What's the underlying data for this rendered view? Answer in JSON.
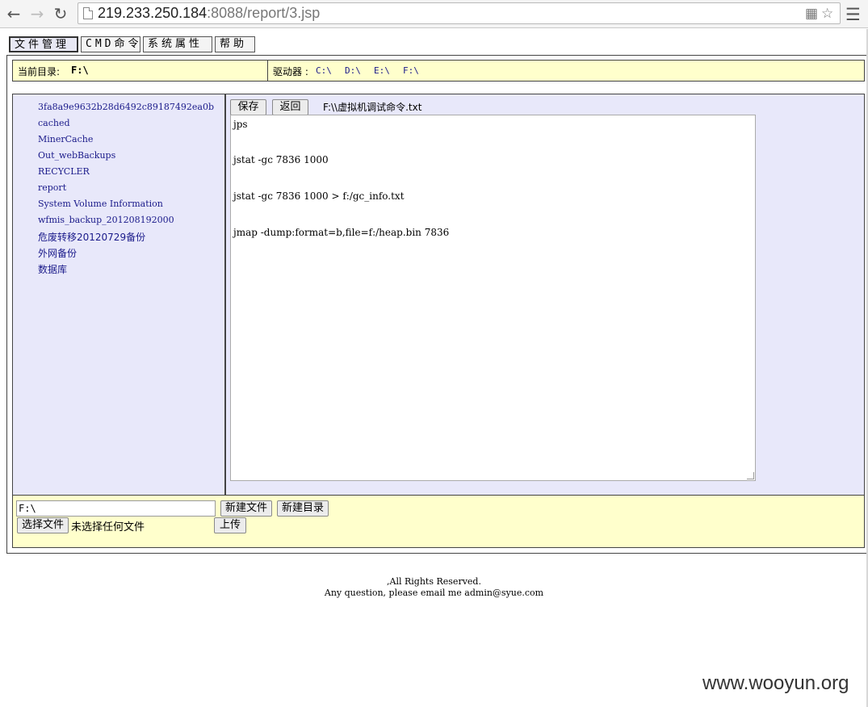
{
  "browser": {
    "url_host": "219.233.250.184",
    "url_rest": ":8088/report/3.jsp"
  },
  "tabs": [
    {
      "label": "文件管理"
    },
    {
      "label": "CMD命令"
    },
    {
      "label": "系统属性"
    },
    {
      "label": "帮助"
    }
  ],
  "path_bar": {
    "label": "当前目录:",
    "value": "F:\\",
    "drives_label": "驱动器 :",
    "drives": [
      "C:\\",
      "D:\\",
      "E:\\",
      "F:\\"
    ]
  },
  "directories": [
    "3fa8a9e9632b28d6492c89187492ea0b",
    "cached",
    "MinerCache",
    "Out_webBackups",
    "RECYCLER",
    "report",
    "System Volume Information",
    "wfmis_backup_201208192000",
    "危废转移20120729备份",
    "外网备份",
    "数据库"
  ],
  "editor": {
    "save_label": "保存",
    "back_label": "返回",
    "file_path": "F:\\\\虚拟机调试命令.txt",
    "lines": [
      "jps",
      "jstat -gc 7836 1000",
      "jstat -gc 7836 1000 > f:/gc_info.txt",
      "jmap -dump:format=b,file=f:/heap.bin 7836"
    ]
  },
  "bottom": {
    "path_value": "F:\\",
    "new_file_label": "新建文件",
    "new_dir_label": "新建目录",
    "choose_file_label": "选择文件",
    "no_file_text": "未选择任何文件",
    "upload_label": "上传"
  },
  "footer": {
    "line1": ",All Rights Reserved.",
    "line2": "Any question, please email me admin@syue.com"
  },
  "watermark": "www.wooyun.org"
}
